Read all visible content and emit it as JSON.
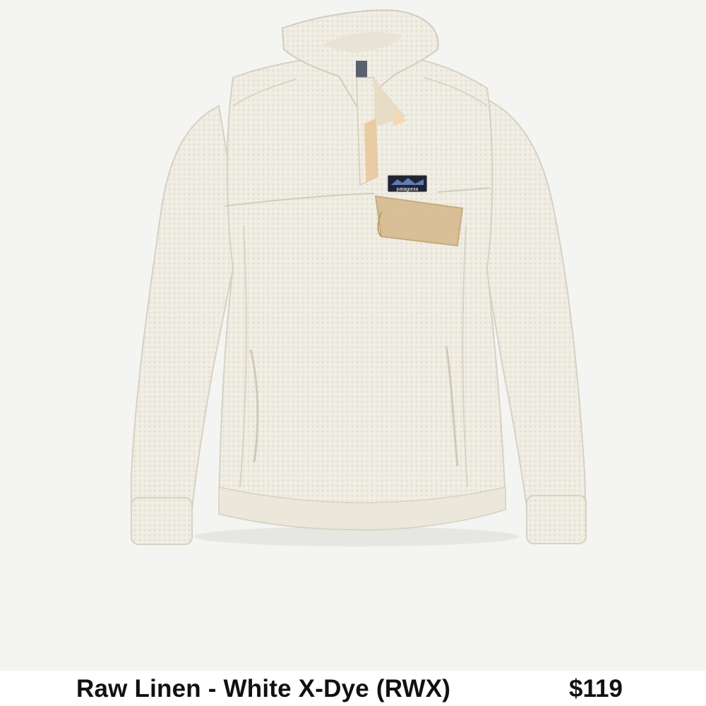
{
  "product": {
    "variant_name": "Raw Linen - White X-Dye (RWX)",
    "price": "$119",
    "label_brand": "patagonia",
    "colors": {
      "background": "#f4f4f3",
      "fleece": "#eeebe0",
      "accent_tan": "#dcc39b",
      "text": "#111111"
    }
  }
}
